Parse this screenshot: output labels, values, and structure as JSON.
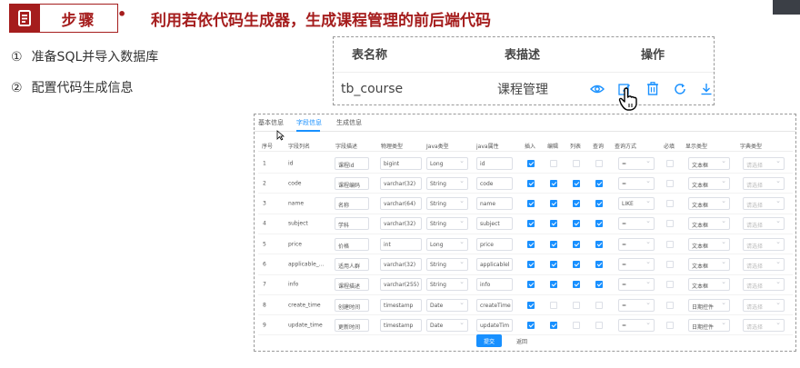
{
  "header": {
    "step_label": "步骤",
    "bullet": "•",
    "title": "利用若依代码生成器，生成课程管理的前后端代码",
    "accent_color": "#a51d1d"
  },
  "steps": [
    {
      "num": "①",
      "text": "准备SQL并导入数据库"
    },
    {
      "num": "②",
      "text": "配置代码生成信息"
    }
  ],
  "table_list": {
    "headers": {
      "name": "表名称",
      "desc": "表描述",
      "actions": "操作"
    },
    "row": {
      "name": "tb_course",
      "desc": "课程管理"
    },
    "action_icons": [
      "eye-icon",
      "edit-icon",
      "trash-icon",
      "refresh-icon",
      "download-icon"
    ]
  },
  "generator": {
    "tabs": [
      "基本信息",
      "字段信息",
      "生成信息"
    ],
    "active_tab": "字段信息",
    "columns": [
      "序号",
      "字段列名",
      "字段描述",
      "物理类型",
      "Java类型",
      "java属性",
      "插入",
      "编辑",
      "列表",
      "查询",
      "查询方式",
      "必填",
      "显示类型",
      "字典类型"
    ],
    "rows": [
      {
        "no": "1",
        "column": "id",
        "desc": "课程id",
        "physical": "bigint",
        "java_type": "Long",
        "java_prop": "id",
        "insert": true,
        "edit": false,
        "list": false,
        "query": false,
        "query_mode": "=",
        "required": false,
        "display": "文本框",
        "dict": "请选择"
      },
      {
        "no": "2",
        "column": "code",
        "desc": "课程编码",
        "physical": "varchar(32)",
        "java_type": "String",
        "java_prop": "code",
        "insert": true,
        "edit": true,
        "list": true,
        "query": true,
        "query_mode": "=",
        "required": false,
        "display": "文本框",
        "dict": "请选择"
      },
      {
        "no": "3",
        "column": "name",
        "desc": "名称",
        "physical": "varchar(64)",
        "java_type": "String",
        "java_prop": "name",
        "insert": true,
        "edit": true,
        "list": true,
        "query": true,
        "query_mode": "LIKE",
        "required": false,
        "display": "文本框",
        "dict": "请选择"
      },
      {
        "no": "4",
        "column": "subject",
        "desc": "学科",
        "physical": "varchar(32)",
        "java_type": "String",
        "java_prop": "subject",
        "insert": true,
        "edit": true,
        "list": true,
        "query": true,
        "query_mode": "=",
        "required": false,
        "display": "文本框",
        "dict": "请选择"
      },
      {
        "no": "5",
        "column": "price",
        "desc": "价格",
        "physical": "int",
        "java_type": "Long",
        "java_prop": "price",
        "insert": true,
        "edit": true,
        "list": true,
        "query": true,
        "query_mode": "=",
        "required": false,
        "display": "文本框",
        "dict": "请选择"
      },
      {
        "no": "6",
        "column": "applicable_...",
        "desc": "适用人群",
        "physical": "varchar(32)",
        "java_type": "String",
        "java_prop": "applicablel",
        "insert": true,
        "edit": true,
        "list": true,
        "query": true,
        "query_mode": "=",
        "required": false,
        "display": "文本框",
        "dict": "请选择"
      },
      {
        "no": "7",
        "column": "info",
        "desc": "课程描述",
        "physical": "varchar(255)",
        "java_type": "String",
        "java_prop": "info",
        "insert": true,
        "edit": true,
        "list": true,
        "query": true,
        "query_mode": "=",
        "required": false,
        "display": "文本框",
        "dict": "请选择"
      },
      {
        "no": "8",
        "column": "create_time",
        "desc": "创建时间",
        "physical": "timestamp",
        "java_type": "Date",
        "java_prop": "createTime",
        "insert": true,
        "edit": false,
        "list": false,
        "query": false,
        "query_mode": "=",
        "required": false,
        "display": "日期控件",
        "dict": "请选择"
      },
      {
        "no": "9",
        "column": "update_time",
        "desc": "更新时间",
        "physical": "timestamp",
        "java_type": "Date",
        "java_prop": "updateTim",
        "insert": true,
        "edit": true,
        "list": false,
        "query": false,
        "query_mode": "=",
        "required": false,
        "display": "日期控件",
        "dict": "请选择"
      }
    ],
    "submit_label": "提交",
    "back_label": "返回",
    "accent_color": "#1890ff"
  }
}
